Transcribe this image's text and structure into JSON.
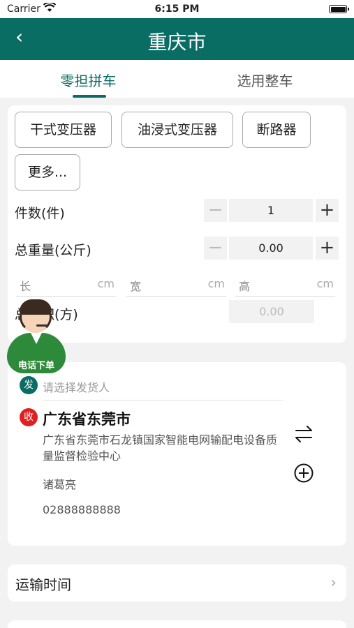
{
  "status_bar": {
    "carrier": "Carrier",
    "time": "6:15 PM"
  },
  "nav": {
    "back_icon": "‹",
    "title": "重庆市"
  },
  "tabs": [
    {
      "label": "零担拼车",
      "active": true
    },
    {
      "label": "选用整车",
      "active": false
    }
  ],
  "categories": [
    "干式变压器",
    "油浸式变压器",
    "断路器",
    "更多..."
  ],
  "quantity": {
    "label": "件数(件)",
    "value": "1"
  },
  "weight": {
    "label": "总重量(公斤)",
    "value": "0.00"
  },
  "dimensions": [
    {
      "label": "长",
      "unit": "cm"
    },
    {
      "label": "宽",
      "unit": "cm"
    },
    {
      "label": "高",
      "unit": "cm"
    }
  ],
  "volume": {
    "label": "总体积(方)",
    "value": "0.00"
  },
  "agent": {
    "label": "电话下单"
  },
  "sender": {
    "badge": "发",
    "placeholder": "请选择发货人"
  },
  "receiver": {
    "badge": "收",
    "city": "广东省东莞市",
    "address": "广东省东莞市石龙镇国家智能电网输配电设备质量监督检验中心",
    "name": "诸葛亮",
    "phone": "02888888888"
  },
  "transport_time": {
    "label": "运输时间",
    "chevron": "›"
  },
  "colors": {
    "primary": "#0a6d64",
    "receive_badge": "#e02020"
  }
}
